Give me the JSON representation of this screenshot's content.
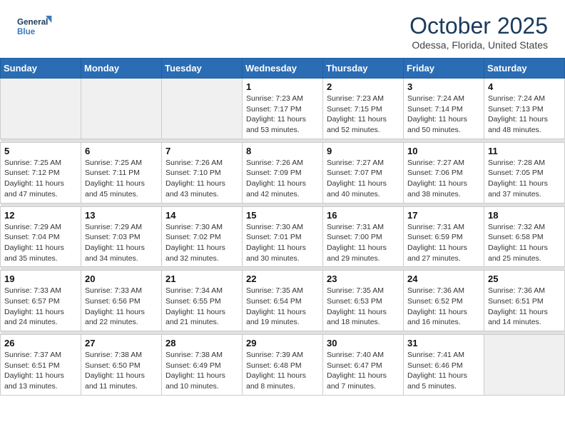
{
  "logo": {
    "line1": "General",
    "line2": "Blue"
  },
  "header": {
    "month": "October 2025",
    "location": "Odessa, Florida, United States"
  },
  "weekdays": [
    "Sunday",
    "Monday",
    "Tuesday",
    "Wednesday",
    "Thursday",
    "Friday",
    "Saturday"
  ],
  "weeks": [
    [
      {
        "num": "",
        "info": ""
      },
      {
        "num": "",
        "info": ""
      },
      {
        "num": "",
        "info": ""
      },
      {
        "num": "1",
        "info": "Sunrise: 7:23 AM\nSunset: 7:17 PM\nDaylight: 11 hours\nand 53 minutes."
      },
      {
        "num": "2",
        "info": "Sunrise: 7:23 AM\nSunset: 7:15 PM\nDaylight: 11 hours\nand 52 minutes."
      },
      {
        "num": "3",
        "info": "Sunrise: 7:24 AM\nSunset: 7:14 PM\nDaylight: 11 hours\nand 50 minutes."
      },
      {
        "num": "4",
        "info": "Sunrise: 7:24 AM\nSunset: 7:13 PM\nDaylight: 11 hours\nand 48 minutes."
      }
    ],
    [
      {
        "num": "5",
        "info": "Sunrise: 7:25 AM\nSunset: 7:12 PM\nDaylight: 11 hours\nand 47 minutes."
      },
      {
        "num": "6",
        "info": "Sunrise: 7:25 AM\nSunset: 7:11 PM\nDaylight: 11 hours\nand 45 minutes."
      },
      {
        "num": "7",
        "info": "Sunrise: 7:26 AM\nSunset: 7:10 PM\nDaylight: 11 hours\nand 43 minutes."
      },
      {
        "num": "8",
        "info": "Sunrise: 7:26 AM\nSunset: 7:09 PM\nDaylight: 11 hours\nand 42 minutes."
      },
      {
        "num": "9",
        "info": "Sunrise: 7:27 AM\nSunset: 7:07 PM\nDaylight: 11 hours\nand 40 minutes."
      },
      {
        "num": "10",
        "info": "Sunrise: 7:27 AM\nSunset: 7:06 PM\nDaylight: 11 hours\nand 38 minutes."
      },
      {
        "num": "11",
        "info": "Sunrise: 7:28 AM\nSunset: 7:05 PM\nDaylight: 11 hours\nand 37 minutes."
      }
    ],
    [
      {
        "num": "12",
        "info": "Sunrise: 7:29 AM\nSunset: 7:04 PM\nDaylight: 11 hours\nand 35 minutes."
      },
      {
        "num": "13",
        "info": "Sunrise: 7:29 AM\nSunset: 7:03 PM\nDaylight: 11 hours\nand 34 minutes."
      },
      {
        "num": "14",
        "info": "Sunrise: 7:30 AM\nSunset: 7:02 PM\nDaylight: 11 hours\nand 32 minutes."
      },
      {
        "num": "15",
        "info": "Sunrise: 7:30 AM\nSunset: 7:01 PM\nDaylight: 11 hours\nand 30 minutes."
      },
      {
        "num": "16",
        "info": "Sunrise: 7:31 AM\nSunset: 7:00 PM\nDaylight: 11 hours\nand 29 minutes."
      },
      {
        "num": "17",
        "info": "Sunrise: 7:31 AM\nSunset: 6:59 PM\nDaylight: 11 hours\nand 27 minutes."
      },
      {
        "num": "18",
        "info": "Sunrise: 7:32 AM\nSunset: 6:58 PM\nDaylight: 11 hours\nand 25 minutes."
      }
    ],
    [
      {
        "num": "19",
        "info": "Sunrise: 7:33 AM\nSunset: 6:57 PM\nDaylight: 11 hours\nand 24 minutes."
      },
      {
        "num": "20",
        "info": "Sunrise: 7:33 AM\nSunset: 6:56 PM\nDaylight: 11 hours\nand 22 minutes."
      },
      {
        "num": "21",
        "info": "Sunrise: 7:34 AM\nSunset: 6:55 PM\nDaylight: 11 hours\nand 21 minutes."
      },
      {
        "num": "22",
        "info": "Sunrise: 7:35 AM\nSunset: 6:54 PM\nDaylight: 11 hours\nand 19 minutes."
      },
      {
        "num": "23",
        "info": "Sunrise: 7:35 AM\nSunset: 6:53 PM\nDaylight: 11 hours\nand 18 minutes."
      },
      {
        "num": "24",
        "info": "Sunrise: 7:36 AM\nSunset: 6:52 PM\nDaylight: 11 hours\nand 16 minutes."
      },
      {
        "num": "25",
        "info": "Sunrise: 7:36 AM\nSunset: 6:51 PM\nDaylight: 11 hours\nand 14 minutes."
      }
    ],
    [
      {
        "num": "26",
        "info": "Sunrise: 7:37 AM\nSunset: 6:51 PM\nDaylight: 11 hours\nand 13 minutes."
      },
      {
        "num": "27",
        "info": "Sunrise: 7:38 AM\nSunset: 6:50 PM\nDaylight: 11 hours\nand 11 minutes."
      },
      {
        "num": "28",
        "info": "Sunrise: 7:38 AM\nSunset: 6:49 PM\nDaylight: 11 hours\nand 10 minutes."
      },
      {
        "num": "29",
        "info": "Sunrise: 7:39 AM\nSunset: 6:48 PM\nDaylight: 11 hours\nand 8 minutes."
      },
      {
        "num": "30",
        "info": "Sunrise: 7:40 AM\nSunset: 6:47 PM\nDaylight: 11 hours\nand 7 minutes."
      },
      {
        "num": "31",
        "info": "Sunrise: 7:41 AM\nSunset: 6:46 PM\nDaylight: 11 hours\nand 5 minutes."
      },
      {
        "num": "",
        "info": ""
      }
    ]
  ]
}
